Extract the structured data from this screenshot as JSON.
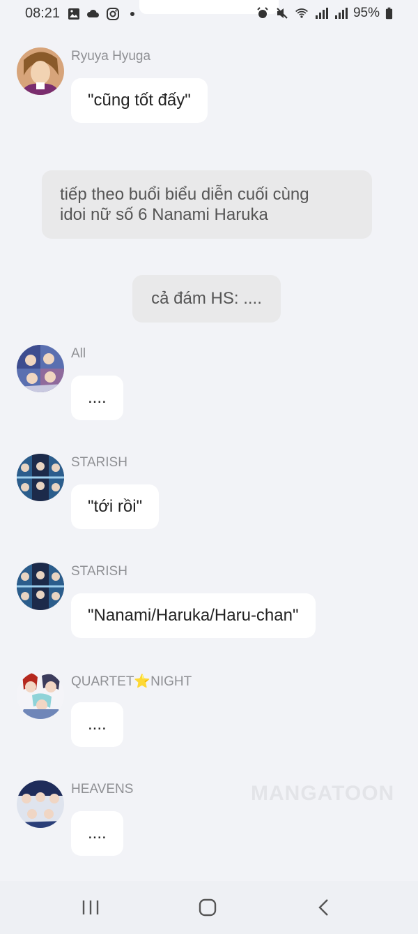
{
  "status_bar": {
    "time": "08:21",
    "battery": "95%"
  },
  "messages": [
    {
      "type": "character",
      "name": "Ryuya Hyuga",
      "text": "\"cũng tốt đấy\""
    },
    {
      "type": "narration",
      "text_lines": [
        "tiếp theo buổi biểu diễn cuối cùng",
        "idoi nữ số 6 Nanami Haruka"
      ]
    },
    {
      "type": "narration",
      "text": "cả đám HS: ...."
    },
    {
      "type": "character",
      "name": "All",
      "text": "...."
    },
    {
      "type": "character",
      "name": "STARISH",
      "text": "\"tới rồi\""
    },
    {
      "type": "character",
      "name": "STARISH",
      "text": "\"Nanami/Haruka/Haru-chan\""
    },
    {
      "type": "character",
      "name": "QUARTET⭐NIGHT",
      "text": "...."
    },
    {
      "type": "character",
      "name": "HEAVENS",
      "text": "...."
    }
  ],
  "watermark": "MANGATOON"
}
